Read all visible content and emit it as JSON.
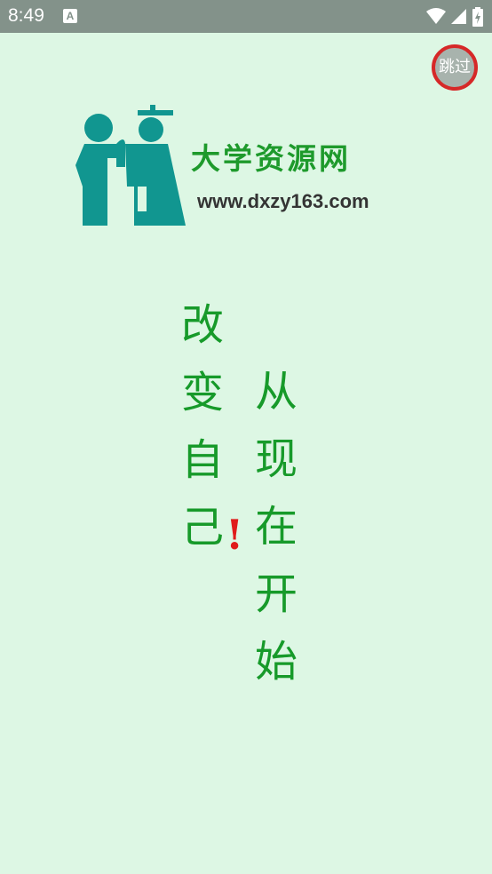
{
  "status_bar": {
    "time": "8:49",
    "app_icon": "A",
    "icons": [
      "wifi-icon",
      "signal-icon",
      "battery-icon"
    ]
  },
  "skip_button": {
    "label": "跳过"
  },
  "brand": {
    "name": "大学资源网",
    "url": "www.dxzy163.com",
    "colors": {
      "logo_teal": "#119690",
      "name_green": "#1e9a2c",
      "url_dark": "#343434"
    }
  },
  "slogan": {
    "left_text": "改变自己",
    "exclamation": "!",
    "right_text": "从现在开始",
    "colors": {
      "text": "#179a2a",
      "exclamation": "#e01b1b"
    }
  },
  "background_color": "#ddf7e4"
}
